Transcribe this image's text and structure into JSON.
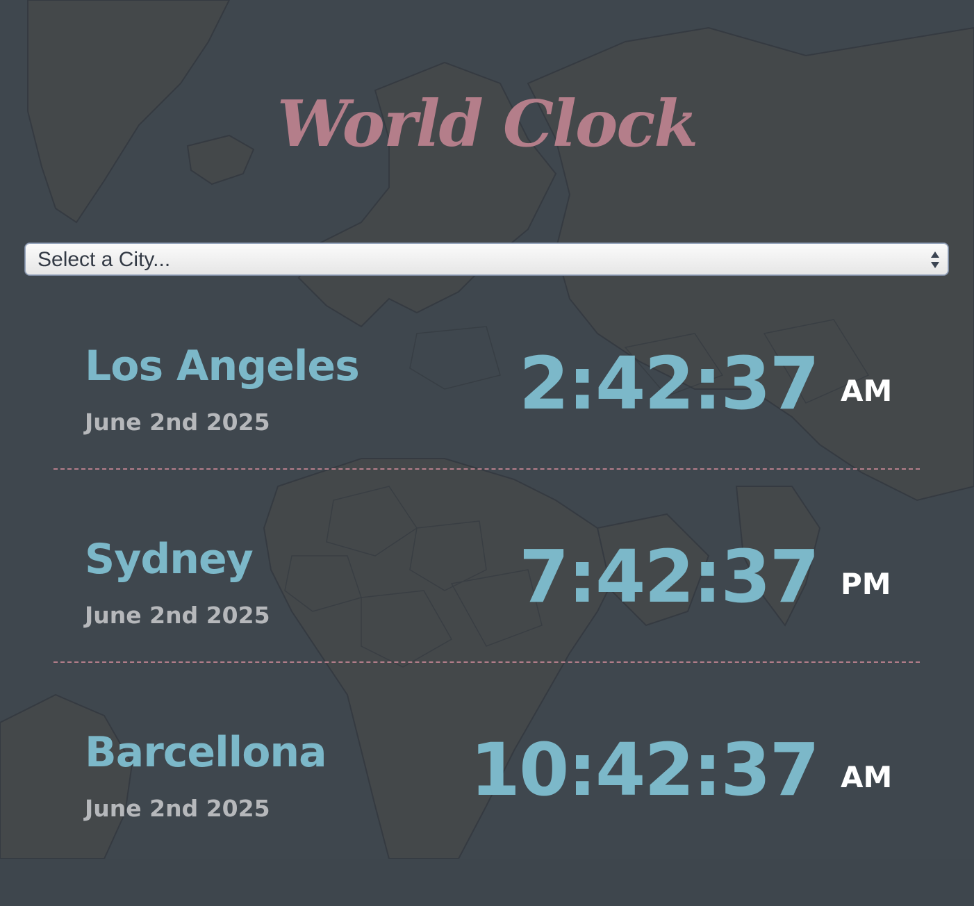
{
  "app": {
    "title": "World Clock"
  },
  "city_select": {
    "value": "Select a City..."
  },
  "cities": [
    {
      "name": "Los Angeles",
      "date": "June 2nd 2025",
      "time": "2:42:37",
      "ampm": "AM"
    },
    {
      "name": "Sydney",
      "date": "June 2nd 2025",
      "time": "7:42:37",
      "ampm": "PM"
    },
    {
      "name": "Barcellona",
      "date": "June 2nd 2025",
      "time": "10:42:37",
      "ampm": "AM"
    }
  ],
  "colors": {
    "title": "#b47e8a",
    "city_name": "#7cb8c9",
    "time": "#7cb8c9",
    "date": "#b6b8bb",
    "ampm": "#ffffff",
    "divider": "#b47e8a",
    "background": "#3e464d"
  }
}
